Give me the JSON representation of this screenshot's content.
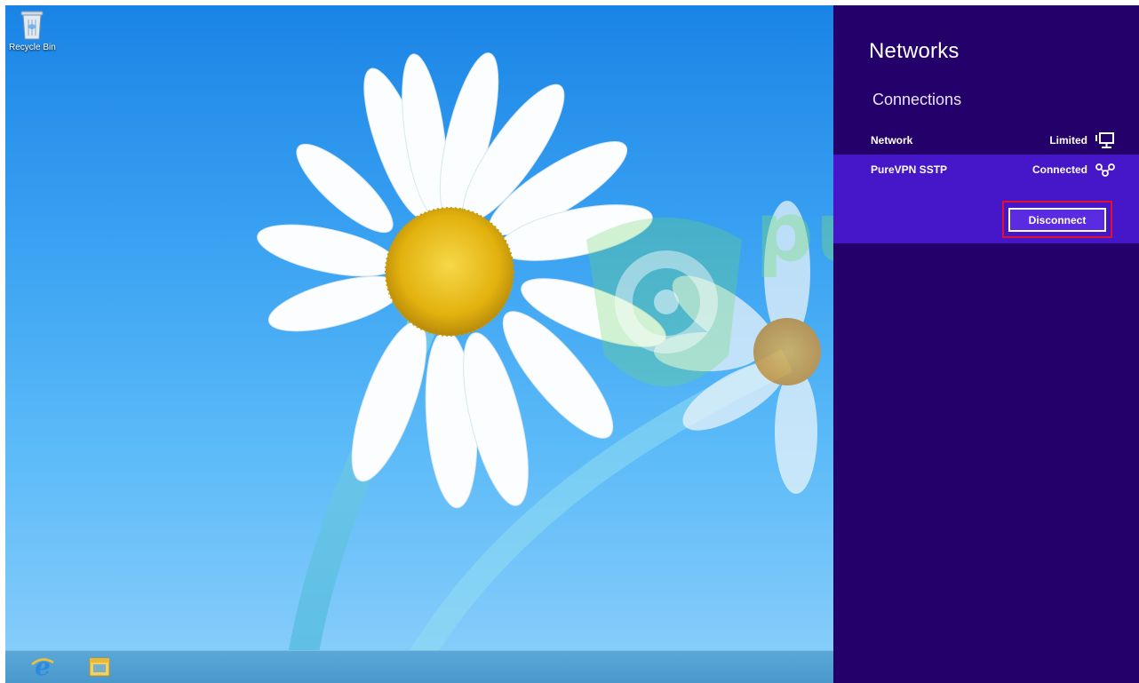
{
  "desktop": {
    "icons": [
      {
        "label": "Recycle Bin",
        "icon": "recycle-bin-icon"
      }
    ],
    "wallpaper": "daisy-flower-on-blue",
    "background_color": "#3aa2f2"
  },
  "taskbar": {
    "items": [
      {
        "name": "internet-explorer",
        "icon": "internet-explorer-icon"
      },
      {
        "name": "file-explorer",
        "icon": "folder-icon"
      }
    ]
  },
  "network_pane": {
    "title": "Networks",
    "section_title": "Connections",
    "background_color": "#24006a",
    "highlight_color": "#4617c9",
    "connections": [
      {
        "name": "Network",
        "status": "Limited",
        "icon": "wired-network-icon"
      },
      {
        "name": "PureVPN SSTP",
        "status": "Connected",
        "icon": "vpn-icon",
        "selected": true
      }
    ],
    "disconnect_label": "Disconnect",
    "callout_color": "#e3112f"
  },
  "watermark": {
    "text": "pure",
    "color": "#78dc78"
  }
}
